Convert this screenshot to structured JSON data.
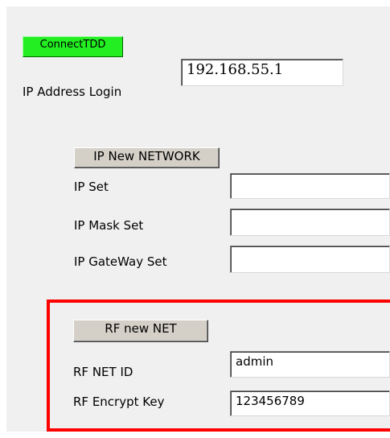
{
  "login": {
    "connect_button": "ConnectTDD",
    "ip_value": "192.168.55.1",
    "ip_label": "IP Address Login"
  },
  "network": {
    "button": "IP New NETWORK",
    "ip_set_label": "IP Set",
    "ip_set_value": "",
    "mask_label": "IP Mask Set",
    "mask_value": "",
    "gateway_label": "IP GateWay Set",
    "gateway_value": ""
  },
  "rf": {
    "button": "RF new NET",
    "net_id_label": "RF NET ID",
    "net_id_value": "admin",
    "encrypt_label": "RF Encrypt Key",
    "encrypt_value": "123456789"
  },
  "colors": {
    "connect_button_bg": "#22ee22",
    "highlight_border": "#ff0000",
    "panel_bg": "#f0f0f0"
  }
}
